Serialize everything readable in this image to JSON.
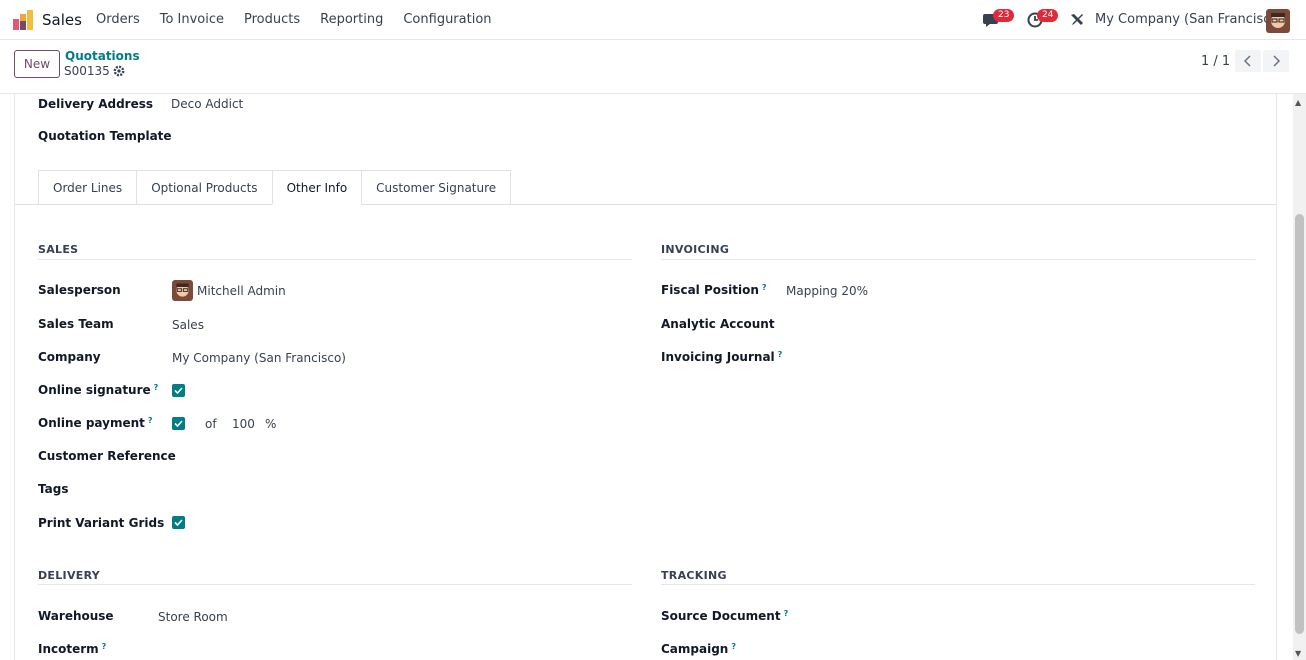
{
  "navbar": {
    "app_name": "Sales",
    "menu": [
      "Orders",
      "To Invoice",
      "Products",
      "Reporting",
      "Configuration"
    ],
    "chat_count": "23",
    "activity_count": "24",
    "company": "My Company (San Francisco)"
  },
  "control_panel": {
    "new_label": "New",
    "breadcrumb": "Quotations",
    "record": "S00135",
    "pager": "1 / 1"
  },
  "header_fields": {
    "delivery_address_label": "Delivery Address",
    "delivery_address_value": "Deco Addict",
    "quotation_template_label": "Quotation Template"
  },
  "tabs": [
    "Order Lines",
    "Optional Products",
    "Other Info",
    "Customer Signature"
  ],
  "sales": {
    "title": "SALES",
    "salesperson_label": "Salesperson",
    "salesperson_value": "Mitchell Admin",
    "sales_team_label": "Sales Team",
    "sales_team_value": "Sales",
    "company_label": "Company",
    "company_value": "My Company (San Francisco)",
    "online_signature_label": "Online signature",
    "online_payment_label": "Online payment",
    "of_label": "of",
    "payment_percent": "100",
    "percent_sign": "%",
    "customer_reference_label": "Customer Reference",
    "tags_label": "Tags",
    "print_variant_grids_label": "Print Variant Grids"
  },
  "invoicing": {
    "title": "INVOICING",
    "fiscal_position_label": "Fiscal Position",
    "fiscal_position_value": "Mapping 20%",
    "analytic_account_label": "Analytic Account",
    "invoicing_journal_label": "Invoicing Journal"
  },
  "delivery": {
    "title": "DELIVERY",
    "warehouse_label": "Warehouse",
    "warehouse_value": "Store Room",
    "incoterm_label": "Incoterm"
  },
  "tracking": {
    "title": "TRACKING",
    "source_document_label": "Source Document",
    "campaign_label": "Campaign"
  },
  "help_mark": "?",
  "colors": {
    "brand": "#714b67",
    "accent": "#017e84",
    "badge": "#e02a3a"
  }
}
